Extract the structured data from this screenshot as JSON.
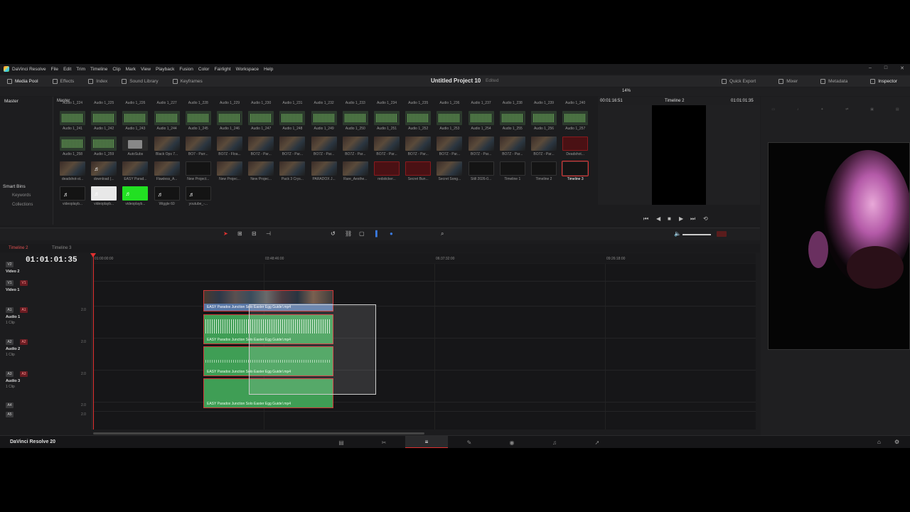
{
  "menubar": {
    "app_name": "DaVinci Resolve",
    "items": [
      "File",
      "Edit",
      "Trim",
      "Timeline",
      "Clip",
      "Mark",
      "View",
      "Playback",
      "Fusion",
      "Color",
      "Fairlight",
      "Workspace",
      "Help"
    ],
    "window_controls": [
      "–",
      "□",
      "✕"
    ]
  },
  "toolbar": {
    "media_pool": "Media Pool",
    "effects": "Effects",
    "index": "Index",
    "sound_library": "Sound Library",
    "keyframes": "Keyframes",
    "project_title": "Untitled Project 10",
    "project_status": "Edited",
    "quick_export": "Quick Export",
    "mixer": "Mixer",
    "metadata": "Metadata",
    "inspector": "Inspector"
  },
  "subbar": {
    "zoom": "14%"
  },
  "left_panel": {
    "bin": "Master",
    "smart_bins": "Smart Bins",
    "smart_items": [
      "Keywords",
      "Collections"
    ]
  },
  "pool": {
    "header": "Master",
    "row0": [
      "Audio 1_224",
      "Audio 1_225",
      "Audio 1_226",
      "Audio 1_227",
      "Audio 1_228",
      "Audio 1_229",
      "Audio 1_230",
      "Audio 1_231",
      "Audio 1_232",
      "Audio 1_233",
      "Audio 1_234",
      "Audio 1_235",
      "Audio 1_236",
      "Audio 1_237",
      "Audio 1_238",
      "Audio 1_239",
      "Audio 1_240"
    ],
    "row1": [
      "Audio 1_241",
      "Audio 1_242",
      "Audio 1_243",
      "Audio 1_244",
      "Audio 1_245",
      "Audio 1_246",
      "Audio 1_247",
      "Audio 1_248",
      "Audio 1_249",
      "Audio 1_250",
      "Audio 1_251",
      "Audio 1_252",
      "Audio 1_253",
      "Audio 1_254",
      "Audio 1_255",
      "Audio 1_256",
      "Audio 1_257"
    ],
    "row2": [
      "Audio 1_258",
      "Audio 1_259",
      "AutoSubs",
      "Black Ops 7...",
      "BO7 - Parr...",
      "BO7Z - Floa...",
      "BO7Z - Par...",
      "BO7Z - Par...",
      "BO7Z - Par...",
      "BO7Z - Par...",
      "BO7Z - Par...",
      "BO7Z - Par...",
      "BO7Z - Par...",
      "BO7Z - Par...",
      "BO7Z - Par...",
      "BO7Z - Par...",
      "Deadshot..."
    ],
    "row3": [
      "deadshot-st...",
      "download (...",
      "EASY Parad...",
      "Flawless_A...",
      "New Project...",
      "New Projec...",
      "New Projec...",
      "Pack 3 Crys...",
      "PARADOX J...",
      "Rare_Aesthe...",
      "redsticker...",
      "Secret Bun...",
      "Secret Song...",
      "Still 2026-0...",
      "Timeline 1",
      "Timeline 2",
      "Timeline 3"
    ],
    "row4": [
      "videoplayb...",
      "videoplayb...",
      "videoplayb...",
      "Wiggle 60",
      "youtube_-..."
    ]
  },
  "viewer": {
    "timecode_left": "00:01:16:51",
    "timeline_name": "Timeline 2",
    "timecode_right": "01:01:01:35"
  },
  "timeline": {
    "tabs": [
      "Timeline 2",
      "Timeline 3"
    ],
    "current_tc": "01:01:01:35",
    "ruler": [
      "01:00:00:00",
      "03:48:46:00",
      "06:37:32:00",
      "09:26:18:00"
    ],
    "tracks": [
      {
        "id": "V2",
        "name": "Video 2",
        "sub": ""
      },
      {
        "id": "V1",
        "name": "Video 1",
        "sub": ""
      },
      {
        "id": "A1",
        "name": "Audio 1",
        "sub": "1 Clip",
        "vol": "2.0"
      },
      {
        "id": "A2",
        "name": "Audio 2",
        "sub": "1 Clip",
        "vol": "2.0"
      },
      {
        "id": "A3",
        "name": "Audio 3",
        "sub": "1 Clip",
        "vol": "2.0"
      },
      {
        "id": "A4",
        "name": "",
        "sub": "",
        "vol": "2.0"
      },
      {
        "id": "A5",
        "name": "",
        "sub": "",
        "vol": "2.0"
      }
    ],
    "clip_name": "EASY Paradox Junction Solo Easter Egg Guide!.mp4"
  },
  "bottom": {
    "brand": "DaVinci Resolve 20"
  },
  "colors": {
    "accent_red": "#e03030",
    "audio_green": "#3f9e55",
    "video_blue": "#5a78a6"
  }
}
